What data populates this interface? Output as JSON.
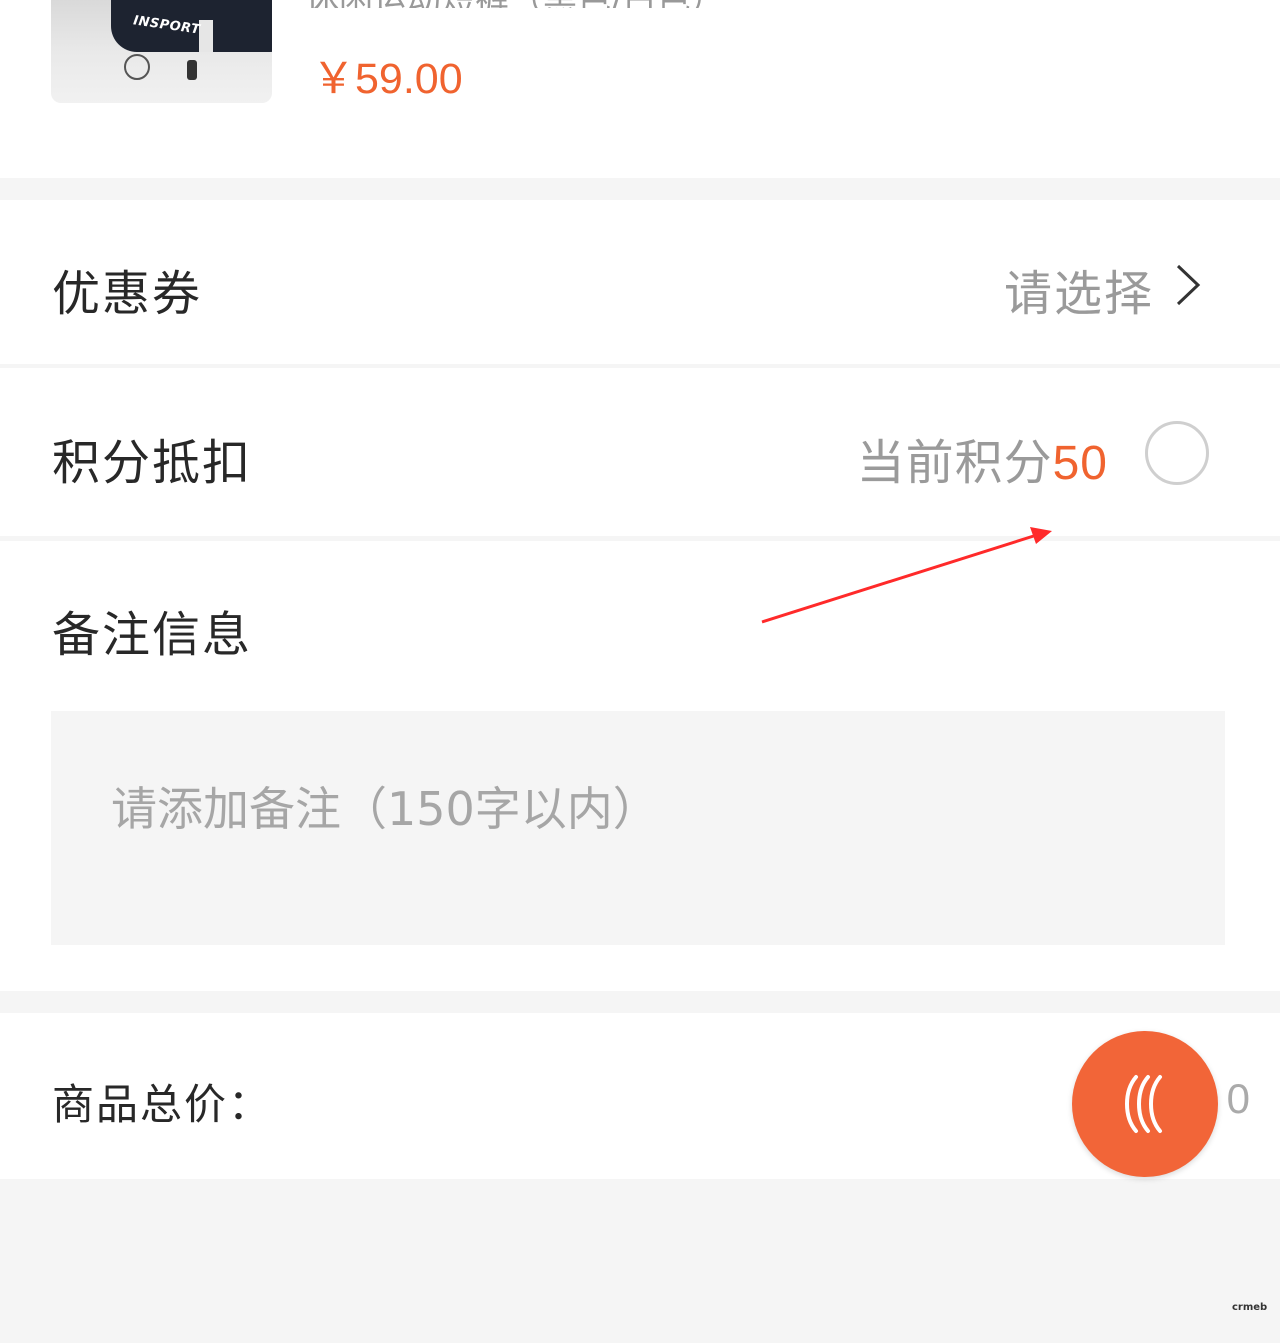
{
  "product": {
    "title": "休闲运动短裤（黑色/白色）",
    "price": "￥59.00",
    "image_brand_text": "INSPORT"
  },
  "coupon": {
    "label": "优惠券",
    "value": "请选择",
    "chevron_icon": "chevron-right-icon"
  },
  "points": {
    "label": "积分抵扣",
    "current_label": "当前积分",
    "current_value": "50",
    "checked": false
  },
  "note": {
    "label": "备注信息",
    "placeholder": "请添加备注（150字以内）",
    "value": ""
  },
  "total": {
    "label": "商品总价：",
    "value": "0"
  },
  "fab": {
    "icon": "wave-icon"
  },
  "watermark": "crmeb",
  "colors": {
    "accent": "#f0632f",
    "background": "#f5f5f5",
    "muted_text": "#9a9a9a",
    "annotation_arrow": "#ff2a2a"
  }
}
